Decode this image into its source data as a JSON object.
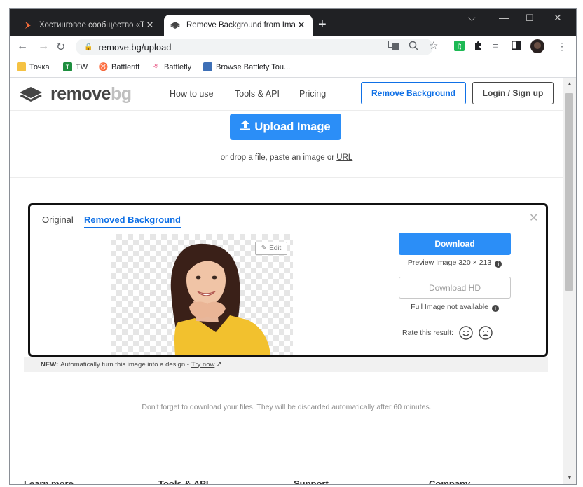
{
  "browser": {
    "tabs": [
      {
        "title": "Хостинговое сообщество «Time",
        "active": false
      },
      {
        "title": "Remove Background from Image",
        "active": true
      }
    ],
    "url": "remove.bg/upload",
    "bookmarks": [
      "Точка",
      "TW",
      "Battleriff",
      "Battlefly",
      "Browse Battlefy Tou..."
    ]
  },
  "site": {
    "logo_primary": "remove",
    "logo_secondary": "bg",
    "nav": [
      "How to use",
      "Tools & API",
      "Pricing"
    ],
    "remove_background_button": "Remove Background",
    "login_button": "Login / Sign up"
  },
  "upload": {
    "button": "Upload Image",
    "drop_prefix": "or drop a file, paste an image or",
    "url_link": "URL"
  },
  "result": {
    "tab_original": "Original",
    "tab_removed": "Removed Background",
    "edit_button": "Edit",
    "download_button": "Download",
    "preview_info": "Preview Image 320 × 213",
    "download_hd_button": "Download HD",
    "full_image_info": "Full Image not available",
    "rate_label": "Rate this result:"
  },
  "new_banner": {
    "label": "NEW:",
    "text": "Automatically turn this image into a design -",
    "link": "Try now"
  },
  "discard_notice": "Don't forget to download your files. They will be discarded automatically after 60 minutes.",
  "footer_headings": [
    "Learn more",
    "Tools & API",
    "Support",
    "Company"
  ],
  "colors": {
    "accent": "#2b8ef7",
    "link": "#0f70e6",
    "tab_strip": "#202124"
  }
}
